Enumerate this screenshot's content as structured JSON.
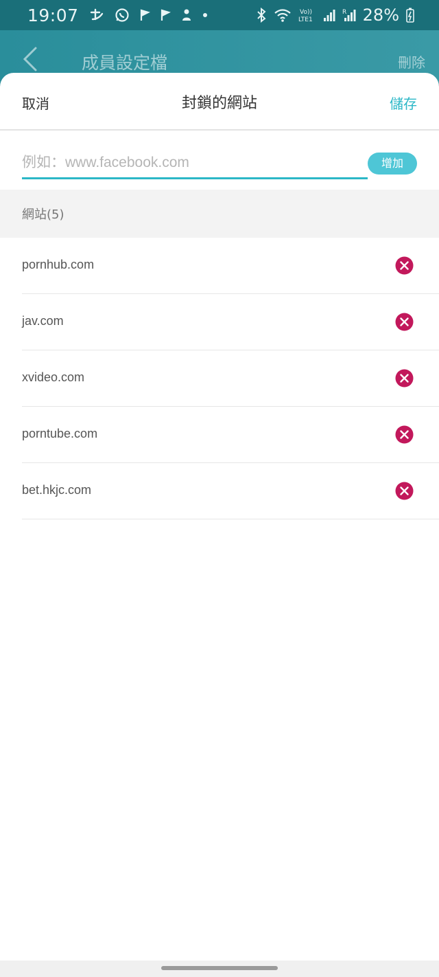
{
  "status": {
    "time": "19:07",
    "battery": "28%"
  },
  "appbar": {
    "title": "成員設定檔",
    "delete_label": "刪除"
  },
  "sheet": {
    "cancel_label": "取消",
    "title": "封鎖的網站",
    "save_label": "儲存",
    "input_placeholder": "例如：www.facebook.com",
    "input_value": "",
    "add_label": "增加",
    "section_label": "網站(5)",
    "sites": [
      {
        "domain": "pornhub.com"
      },
      {
        "domain": "jav.com"
      },
      {
        "domain": "xvideo.com"
      },
      {
        "domain": "porntube.com"
      },
      {
        "domain": "bet.hkjc.com"
      }
    ]
  },
  "colors": {
    "accent": "#2bb7c7",
    "add_button": "#4ec6d6",
    "remove_icon": "#c2185b",
    "appbar": "#2a8e9b"
  },
  "icons": {
    "back": "chevron-left-icon",
    "remove": "close-circle-icon"
  }
}
